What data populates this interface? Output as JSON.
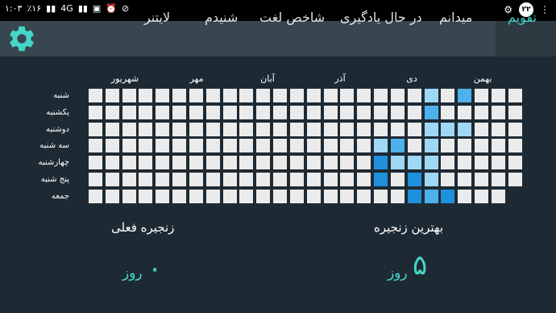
{
  "status_bar": {
    "time": "۱:۰۳",
    "battery": "٪۱۶",
    "network": "4G",
    "notification_badge": "۲۲"
  },
  "tabs": [
    {
      "label": "تقویم",
      "active": true
    },
    {
      "label": "میدانم"
    },
    {
      "label": "در حال یادگیری"
    },
    {
      "label": "شاخص لغت"
    },
    {
      "label": "شنیدم"
    },
    {
      "label": "لایتنر"
    }
  ],
  "settings_icon": "gear-icon",
  "calendar": {
    "months": [
      "بهمن",
      "دی",
      "آذر",
      "آبان",
      "مهر",
      "شهریور"
    ],
    "days": [
      "شنبه",
      "یکشنبه",
      "دوشنبه",
      "سه شنبه",
      "چهارشنبه",
      "پنج شنبه",
      "جمعه"
    ],
    "columns": 26,
    "last_column_rows": 6,
    "colors": {
      "empty": "#ebebeb",
      "l1": "#9fd8f5",
      "l2": "#4db2ec",
      "l3": "#1e90dc"
    },
    "activity": [
      {
        "col": 20,
        "row": 0,
        "level": 1
      },
      {
        "col": 22,
        "row": 0,
        "level": 2
      },
      {
        "col": 20,
        "row": 1,
        "level": 2
      },
      {
        "col": 20,
        "row": 2,
        "level": 1
      },
      {
        "col": 21,
        "row": 2,
        "level": 1
      },
      {
        "col": 22,
        "row": 2,
        "level": 1
      },
      {
        "col": 17,
        "row": 3,
        "level": 1
      },
      {
        "col": 18,
        "row": 3,
        "level": 2
      },
      {
        "col": 20,
        "row": 3,
        "level": 1
      },
      {
        "col": 17,
        "row": 4,
        "level": 3
      },
      {
        "col": 18,
        "row": 4,
        "level": 1
      },
      {
        "col": 19,
        "row": 4,
        "level": 1
      },
      {
        "col": 20,
        "row": 4,
        "level": 1
      },
      {
        "col": 17,
        "row": 5,
        "level": 3
      },
      {
        "col": 19,
        "row": 5,
        "level": 3
      },
      {
        "col": 20,
        "row": 5,
        "level": 1
      },
      {
        "col": 19,
        "row": 6,
        "level": 3
      },
      {
        "col": 20,
        "row": 6,
        "level": 2
      },
      {
        "col": 21,
        "row": 6,
        "level": 3
      }
    ]
  },
  "streaks": {
    "current": {
      "title": "زنجیره فعلی",
      "value": "۰",
      "unit": "روز"
    },
    "best": {
      "title": "بهترین زنجیره",
      "value": "۵",
      "unit": "روز"
    }
  }
}
